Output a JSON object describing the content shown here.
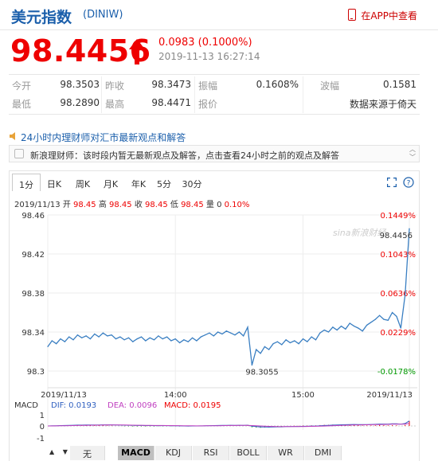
{
  "header": {
    "title": "美元指数",
    "code": "(DINIW)",
    "app_link": "在APP中查看"
  },
  "quote": {
    "price": "98.4456",
    "change": "0.0983 (0.1000%)",
    "timestamp": "2019-11-13 16:27:14"
  },
  "stats": {
    "open_label": "今开",
    "open": "98.3503",
    "prev_close_label": "昨收",
    "prev_close": "98.3473",
    "amplitude_label": "振幅",
    "amplitude": "0.1608%",
    "wave_label": "波幅",
    "wave": "0.1581",
    "low_label": "最低",
    "low": "98.2890",
    "high_label": "最高",
    "high": "98.4471",
    "quote_label": "报价",
    "source": "数据来源于倚天"
  },
  "news": {
    "heading": "24小时内理财师对汇市最新观点和解答",
    "text": "新浪理财师：该时段内暂无最新观点及解答，点击查看24小时之前的观点及解答"
  },
  "tabs": [
    "1分",
    "日K",
    "周K",
    "月K",
    "年K",
    "5分",
    "30分"
  ],
  "ohlc": {
    "date": "2019/11/13",
    "open_label": "开",
    "open": "98.45",
    "high_label": "高",
    "high": "98.45",
    "close_label": "收",
    "close": "98.45",
    "low_label": "低",
    "low": "98.45",
    "vol": "量 0",
    "pct": "0.10%"
  },
  "chart_data": {
    "type": "line",
    "ylim": [
      98.3,
      98.46
    ],
    "y_ticks": [
      "98.46",
      "98.42",
      "98.38",
      "98.34",
      "98.3"
    ],
    "right_ticks": [
      "0.1449%",
      "0.1043%",
      "0.0636%",
      "0.0229%",
      "-0.0178%"
    ],
    "x_ticks": [
      "2019/11/13",
      "14:00",
      "15:00",
      "2019/11/13"
    ],
    "annotations": {
      "last": "98.4456",
      "min": "98.3055",
      "watermark": "sina新浪财经"
    },
    "series": [
      {
        "x": [
          "13:00",
          "13:02",
          "13:04",
          "13:06",
          "13:08",
          "13:10",
          "13:12",
          "13:14",
          "13:16",
          "13:18",
          "13:20",
          "13:22",
          "13:24",
          "13:26",
          "13:28",
          "13:30",
          "13:32",
          "13:34",
          "13:36",
          "13:38",
          "13:40",
          "13:42",
          "13:44",
          "13:46",
          "13:48",
          "13:50",
          "13:52",
          "13:54",
          "13:56",
          "13:58",
          "14:00",
          "14:02",
          "14:04",
          "14:06",
          "14:08",
          "14:10",
          "14:12",
          "14:14",
          "14:16",
          "14:18",
          "14:20",
          "14:22",
          "14:24",
          "14:26",
          "14:28",
          "14:30",
          "14:32",
          "14:34",
          "14:36",
          "14:38",
          "14:40",
          "14:42",
          "14:44",
          "14:46",
          "14:48",
          "14:50",
          "14:52",
          "14:54",
          "14:56",
          "14:58",
          "15:00",
          "15:02",
          "15:04",
          "15:06",
          "15:08",
          "15:10",
          "15:12",
          "15:14",
          "15:16",
          "15:18",
          "15:20",
          "15:22",
          "15:24",
          "15:26",
          "15:28",
          "15:30",
          "15:32",
          "15:34",
          "15:36",
          "15:38",
          "15:40",
          "15:42",
          "15:44",
          "15:46",
          "15:48",
          "15:50"
        ],
        "values": [
          98.325,
          98.331,
          98.328,
          98.333,
          98.33,
          98.335,
          98.332,
          98.337,
          98.334,
          98.336,
          98.333,
          98.338,
          98.335,
          98.339,
          98.336,
          98.337,
          98.333,
          98.335,
          98.332,
          98.334,
          98.33,
          98.333,
          98.335,
          98.331,
          98.334,
          98.332,
          98.336,
          98.333,
          98.335,
          98.331,
          98.333,
          98.329,
          98.332,
          98.33,
          98.334,
          98.331,
          98.335,
          98.337,
          98.339,
          98.336,
          98.34,
          98.338,
          98.341,
          98.339,
          98.337,
          98.34,
          98.336,
          98.345,
          98.306,
          98.322,
          98.318,
          98.325,
          98.322,
          98.328,
          98.33,
          98.327,
          98.332,
          98.329,
          98.331,
          98.328,
          98.333,
          98.33,
          98.335,
          98.332,
          98.339,
          98.342,
          98.34,
          98.345,
          98.342,
          98.346,
          98.343,
          98.349,
          98.346,
          98.344,
          98.341,
          98.347,
          98.35,
          98.353,
          98.357,
          98.353,
          98.352,
          98.36,
          98.356,
          98.344,
          98.378,
          98.446
        ]
      }
    ],
    "macd": {
      "label": "MACD",
      "dif": "DIF: 0.0193",
      "dea": "DEA: 0.0096",
      "macd": "MACD: 0.0195",
      "y_ticks": [
        "1",
        "0",
        "-1"
      ]
    }
  },
  "indicators": [
    "无",
    "MACD",
    "KDJ",
    "RSI",
    "BOLL",
    "WR",
    "DMI"
  ],
  "colors": {
    "up": "#e00",
    "line": "#3a7fc2",
    "dif": "#c040c0",
    "dea": "#3060c0",
    "brand": "#1b5fab"
  }
}
